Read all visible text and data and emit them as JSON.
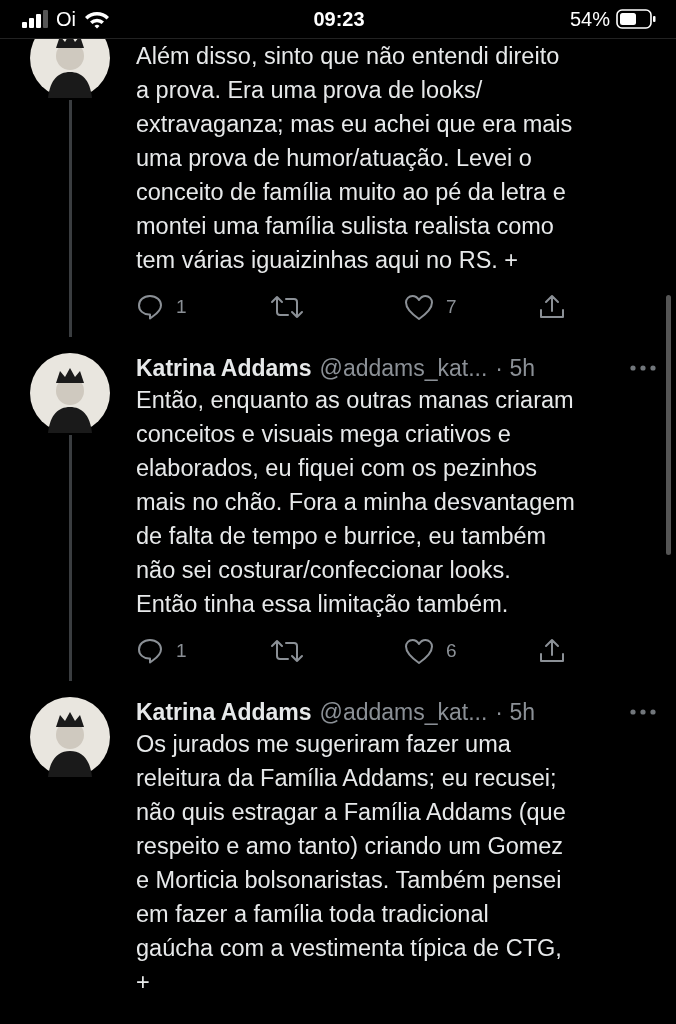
{
  "status_bar": {
    "carrier": "Oi",
    "time": "09:23",
    "battery": "54%"
  },
  "tweets": [
    {
      "lines": [
        "Além disso, sinto que não entendi direito",
        "a prova. Era uma prova de looks/",
        "extravaganza; mas eu achei que era mais",
        "uma prova de humor/atuação. Levei o",
        "conceito de família muito ao pé da letra e",
        "montei uma família sulista realista como",
        "tem várias iguaizinhas aqui no RS. +"
      ],
      "replies": "1",
      "likes": "7"
    },
    {
      "name": "Katrina Addams",
      "handle": "@addams_kat...",
      "time": "· 5h",
      "lines": [
        "Então, enquanto as outras manas criaram",
        "conceitos e visuais mega criativos e",
        "elaborados, eu fiquei com os pezinhos",
        "mais no chão. Fora a minha desvantagem",
        "de falta de tempo e burrice, eu também",
        "não sei costurar/confeccionar looks.",
        "Então tinha essa limitação também."
      ],
      "replies": "1",
      "likes": "6"
    },
    {
      "name": "Katrina Addams",
      "handle": "@addams_kat...",
      "time": "· 5h",
      "lines": [
        "Os jurados me sugeriram fazer uma",
        "releitura da Família Addams; eu recusei;",
        "não quis estragar a Família Addams (que",
        "respeito e amo tanto) criando um Gomez",
        "e Morticia bolsonaristas. Também pensei",
        "em fazer a família toda tradicional",
        "gaúcha com a vestimenta típica de CTG,",
        "+"
      ]
    }
  ]
}
